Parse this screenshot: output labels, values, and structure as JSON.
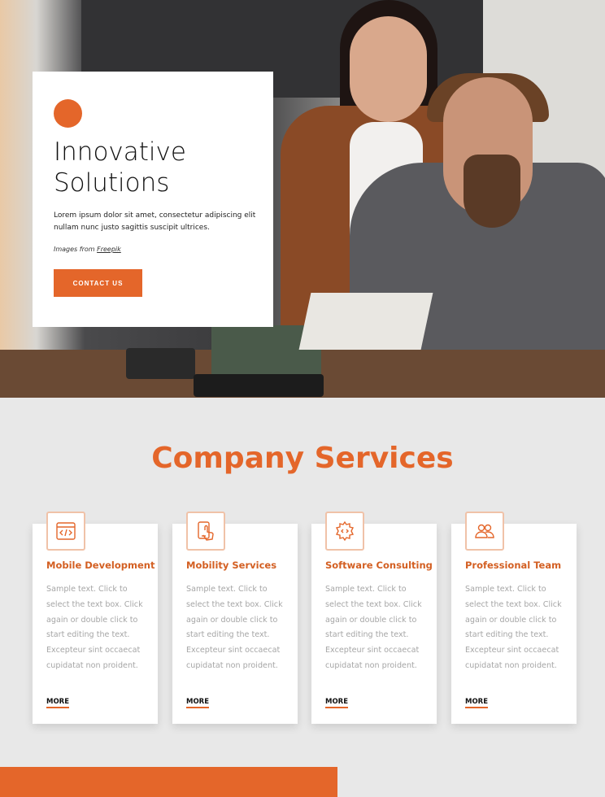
{
  "hero": {
    "title_line1": "Innovative",
    "title_line2": "Solutions",
    "description": "Lorem ipsum dolor sit amet, consectetur adipiscing elit nullam nunc justo sagittis suscipit ultrices.",
    "credit_prefix": "Images from",
    "credit_link": "Freepik",
    "cta_label": "CONTACT US"
  },
  "services": {
    "title": "Company Services",
    "more_label": "MORE",
    "items": [
      {
        "title": "Mobile Development",
        "icon": "code-window-icon",
        "text": "Sample text. Click to select the text box. Click again or double click to start editing the text. Excepteur sint occaecat cupidatat non proident."
      },
      {
        "title": "Mobility Services",
        "icon": "touch-phone-icon",
        "text": "Sample text. Click to select the text box. Click again or double click to start editing the text. Excepteur sint occaecat cupidatat non proident."
      },
      {
        "title": "Software Consulting",
        "icon": "gear-code-icon",
        "text": "Sample text. Click to select the text box. Click again or double click to start editing the text. Excepteur sint occaecat cupidatat non proident."
      },
      {
        "title": "Professional Team",
        "icon": "team-icon",
        "text": "Sample text. Click to select the text box. Click again or double click to start editing the text. Excepteur sint occaecat cupidatat non proident."
      }
    ]
  },
  "colors": {
    "accent": "#e4662a",
    "background": "#e8e8e8",
    "card_text": "#a6a6a6"
  }
}
